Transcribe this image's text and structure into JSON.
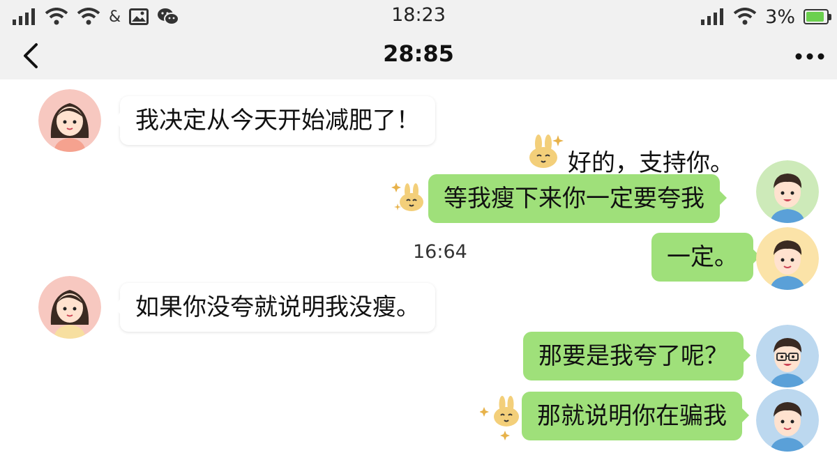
{
  "status_bar": {
    "time": "18:23",
    "battery_percent": "3%",
    "left_icons": [
      "signal-icon",
      "wifi-icon",
      "wifi-icon",
      "ampersand-icon",
      "image-icon",
      "wechat-icon"
    ],
    "ampersand": "&",
    "right_icons": [
      "signal-icon",
      "wifi-icon",
      "battery-icon"
    ],
    "battery_level": 0.9,
    "battery_color": "#6bd04e"
  },
  "header": {
    "title": "28:85",
    "back_icon": "chevron-left-icon",
    "more_icon": "more-dots-icon"
  },
  "colors": {
    "sent_bubble": "#9fe07a",
    "received_bubble": "#ffffff",
    "header_bg": "#f1f1f1"
  },
  "messages": [
    {
      "side": "left",
      "text": "我决定从今天开始减肥了！",
      "avatar": "girl-avatar"
    },
    {
      "side": "right",
      "text": "好的，支持你。",
      "style": "plain",
      "sticker": "bunny-sticker"
    },
    {
      "side": "right",
      "text": "等我瘦下来你一定要夸我",
      "avatar": "boy-avatar",
      "sticker": "bunny-sticker"
    },
    {
      "side": "right",
      "text": "一定。",
      "avatar": "boy-avatar"
    },
    {
      "side": "left",
      "text": "如果你没夸就说明我没瘦。",
      "avatar": "girl-avatar"
    },
    {
      "side": "right",
      "text": "那要是我夸了呢？",
      "avatar": "boy-glasses-avatar"
    },
    {
      "side": "right",
      "text": "那就说明你在骗我",
      "avatar": "boy-avatar",
      "sticker": "bunny-sticker"
    }
  ],
  "timestamp": "16:64"
}
